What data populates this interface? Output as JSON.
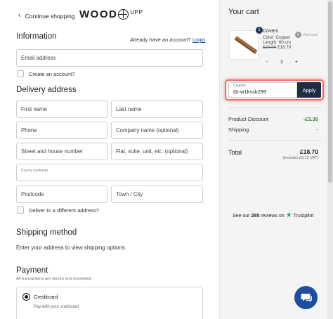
{
  "header": {
    "back_label": "Continue shopping",
    "logo_text_left": "WOOD",
    "logo_text_sup": "UPP"
  },
  "information": {
    "title": "Information",
    "account_prompt": "Already have an account?",
    "login_link": "Login",
    "email_placeholder": "Email address",
    "create_account_label": "Create an account?"
  },
  "delivery": {
    "title": "Delivery address",
    "first_name": "First name",
    "last_name": "Last name",
    "phone": "Phone",
    "company": "Company name (optional)",
    "street": "Street and house number",
    "flat": "Flat, suite, unit, etc. (optional)",
    "county": "County (optional)",
    "postcode": "Postcode",
    "town": "Town / City",
    "different_address_label": "Deliver to a different address?"
  },
  "shipping": {
    "title": "Shipping method",
    "note": "Enter your address to view shipping options."
  },
  "payment": {
    "title": "Payment",
    "note": "All transactions are secure and encrypted.",
    "option_label": "Creditcard",
    "option_sub": "Pay with your creditcard"
  },
  "cart": {
    "title": "Your cart",
    "item": {
      "quantity_badge": "1",
      "name": "Covers",
      "color": "Color: Copper",
      "length": "Length: 60 cm",
      "price_old": "£22.00",
      "price_new": "£18.70",
      "remove_label": "Remove",
      "qty_minus": "-",
      "qty_value": "1",
      "qty_plus": "+"
    },
    "coupon": {
      "label": "Coupon",
      "value": "Gi-w1kssk299",
      "apply_label": "Apply"
    },
    "summary": {
      "discount_label": "Product Discount",
      "discount_value": "-£3.30",
      "shipping_label": "Shipping",
      "shipping_value": "-",
      "total_label": "Total",
      "total_value": "£18.70",
      "vat_note": "(includes £3.12 VAT)"
    },
    "trustpilot": {
      "prefix": "See our",
      "count": "285",
      "suffix": "reviews on",
      "brand": "Trustpilot"
    }
  },
  "colors": {
    "accent_dark": "#1f2d43",
    "discount_green": "#2c8a3c",
    "chat_blue": "#1f4ea1",
    "highlight_red": "#f26b6b"
  },
  "icons": [
    "chevron-left-icon",
    "logo-mark-icon",
    "remove-x-icon",
    "trustpilot-star-icon",
    "chat-icon"
  ]
}
